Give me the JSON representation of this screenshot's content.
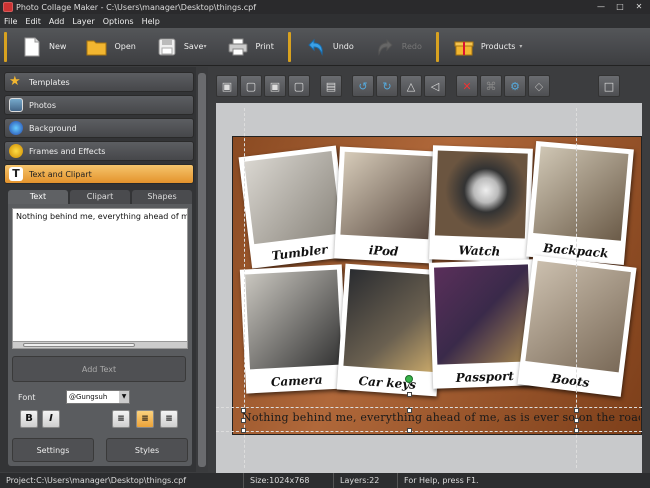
{
  "window": {
    "title": "Photo Collage Maker - C:\\Users\\manager\\Desktop\\things.cpf"
  },
  "menu": [
    "File",
    "Edit",
    "Add",
    "Layer",
    "Options",
    "Help"
  ],
  "toolbar": {
    "new": "New",
    "open": "Open",
    "save": "Save",
    "print": "Print",
    "undo": "Undo",
    "redo": "Redo",
    "products": "Products"
  },
  "sidebar": {
    "items": [
      {
        "label": "Templates",
        "icon": "star-icon"
      },
      {
        "label": "Photos",
        "icon": "photos-icon"
      },
      {
        "label": "Background",
        "icon": "background-icon"
      },
      {
        "label": "Frames and Effects",
        "icon": "frames-icon"
      },
      {
        "label": "Text and Clipart",
        "icon": "text-icon"
      }
    ]
  },
  "tabs": [
    "Text",
    "Clipart",
    "Shapes"
  ],
  "text_panel": {
    "content": "Nothing behind me, everything ahead of me, as is ever so on the road.",
    "add_text": "Add Text",
    "font_label": "Font",
    "font_value": "@Gungsuh",
    "bold": "B",
    "italic": "I",
    "settings": "Settings",
    "styles": "Styles"
  },
  "collage": {
    "photos": [
      {
        "caption": "Tumbler"
      },
      {
        "caption": "iPod"
      },
      {
        "caption": "Watch"
      },
      {
        "caption": "Backpack"
      },
      {
        "caption": "Camera"
      },
      {
        "caption": "Car keys"
      },
      {
        "caption": "Passport"
      },
      {
        "caption": "Boots"
      }
    ],
    "text": "Nothing behind me, everything ahead of me, as is ever so on the road."
  },
  "status": {
    "project": "Project:C:\\Users\\manager\\Desktop\\things.cpf",
    "size": "Size:1024x768",
    "layers": "Layers:22",
    "help": "For Help, press F1."
  },
  "colors": {
    "accent": "#e8a02c",
    "canvas_wood": "#9a5530"
  }
}
